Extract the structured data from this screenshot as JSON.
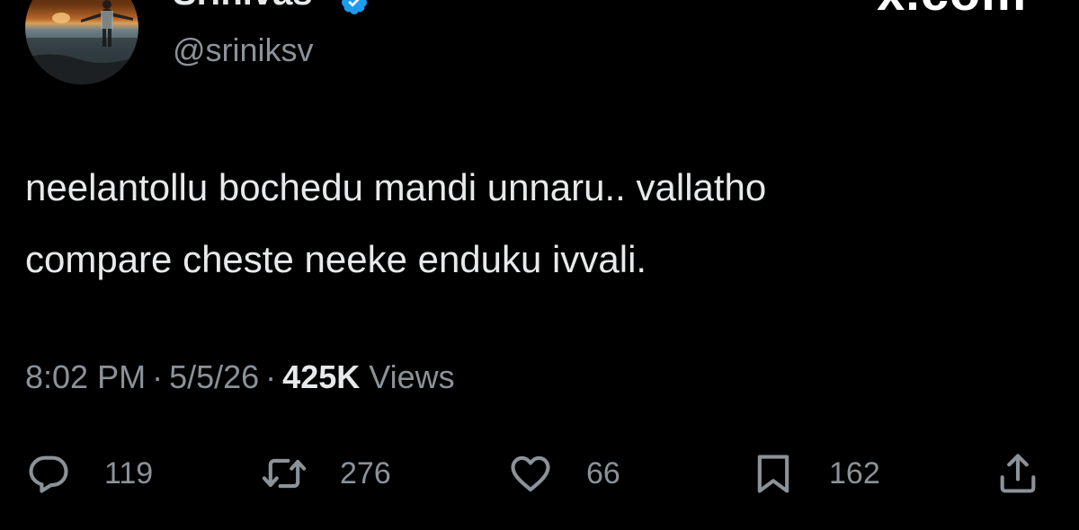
{
  "author": {
    "display_name": "Srinivas",
    "handle": "@sriniksv",
    "verified": true,
    "verified_color": "#1d9bf0"
  },
  "site": {
    "mark": "x.com"
  },
  "tweet": {
    "lines": [
      "neelantollu bochedu mandi unnaru..  vallatho",
      "compare cheste neeke enduku ivvali."
    ]
  },
  "meta": {
    "time": "8:02 PM",
    "separator": "·",
    "date": "5/5/26",
    "views_count": "425K",
    "views_label": "Views"
  },
  "actions": {
    "reply": {
      "icon": "reply-icon",
      "count": "119"
    },
    "retweet": {
      "icon": "retweet-icon",
      "count": "276"
    },
    "like": {
      "icon": "heart-icon",
      "count": "66"
    },
    "bookmark": {
      "icon": "bookmark-icon",
      "count": "162"
    },
    "share": {
      "icon": "share-icon"
    }
  },
  "colors": {
    "background": "#000000",
    "text_primary": "#e7e9ea",
    "text_secondary": "#8b9298"
  }
}
